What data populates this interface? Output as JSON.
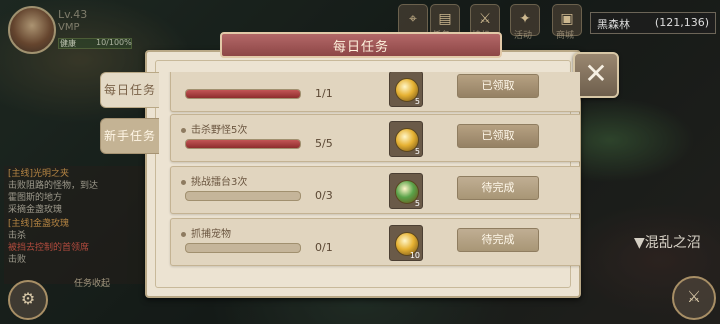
{
  "hud": {
    "name": "Lv.43",
    "sub": "VMP",
    "hp_tag": "健康",
    "hp_value": "10/100%"
  },
  "top_icons": [
    {
      "label": "",
      "icon": "map-icon"
    },
    {
      "label": "任务",
      "icon": "scroll-icon"
    },
    {
      "label": "挂机",
      "icon": "swords-icon"
    },
    {
      "label": "活动",
      "icon": "gift-icon"
    },
    {
      "label": "商城",
      "icon": "treasure-icon"
    }
  ],
  "location": {
    "name": "黑森林",
    "coords": "(121,136)"
  },
  "quest_log": [
    {
      "title": "[主线]光明之夹",
      "lines": [
        "击败阻路的怪物，到达",
        "霍图斯的地方",
        "采摘金盏玫瑰"
      ]
    },
    {
      "title": "[主线]金盏玫瑰",
      "lines": [
        "击杀",
        "被挡去控制的首领席",
        "击败"
      ]
    }
  ],
  "quest_collapse": "任务收起",
  "zone_label": "▼混乱之沼",
  "dialog": {
    "title": "每日任务",
    "close": "✕",
    "tabs": [
      "每日任务",
      "新手任务"
    ],
    "tasks": [
      {
        "name": "",
        "progress": "1/1",
        "fraction": 1.0,
        "reward_qty": "5",
        "reward_color": "#e6b233",
        "button": "已领取",
        "status": "done"
      },
      {
        "name": "击杀野怪5次",
        "progress": "5/5",
        "fraction": 1.0,
        "reward_qty": "5",
        "reward_color": "#e6b233",
        "button": "已领取",
        "status": "done"
      },
      {
        "name": "挑战擂台3次",
        "progress": "0/3",
        "fraction": 0.0,
        "reward_qty": "5",
        "reward_color": "#5aa34a",
        "button": "待完成",
        "status": "pending"
      },
      {
        "name": "抓捕宠物",
        "progress": "0/1",
        "fraction": 0.0,
        "reward_qty": "10",
        "reward_color": "#e6b233",
        "button": "待完成",
        "status": "pending"
      }
    ]
  },
  "colors": {
    "accent_red": "#a84f4f",
    "panel": "#ece3d2",
    "coin_gold": "#e6b233",
    "coin_green": "#5aa34a"
  }
}
